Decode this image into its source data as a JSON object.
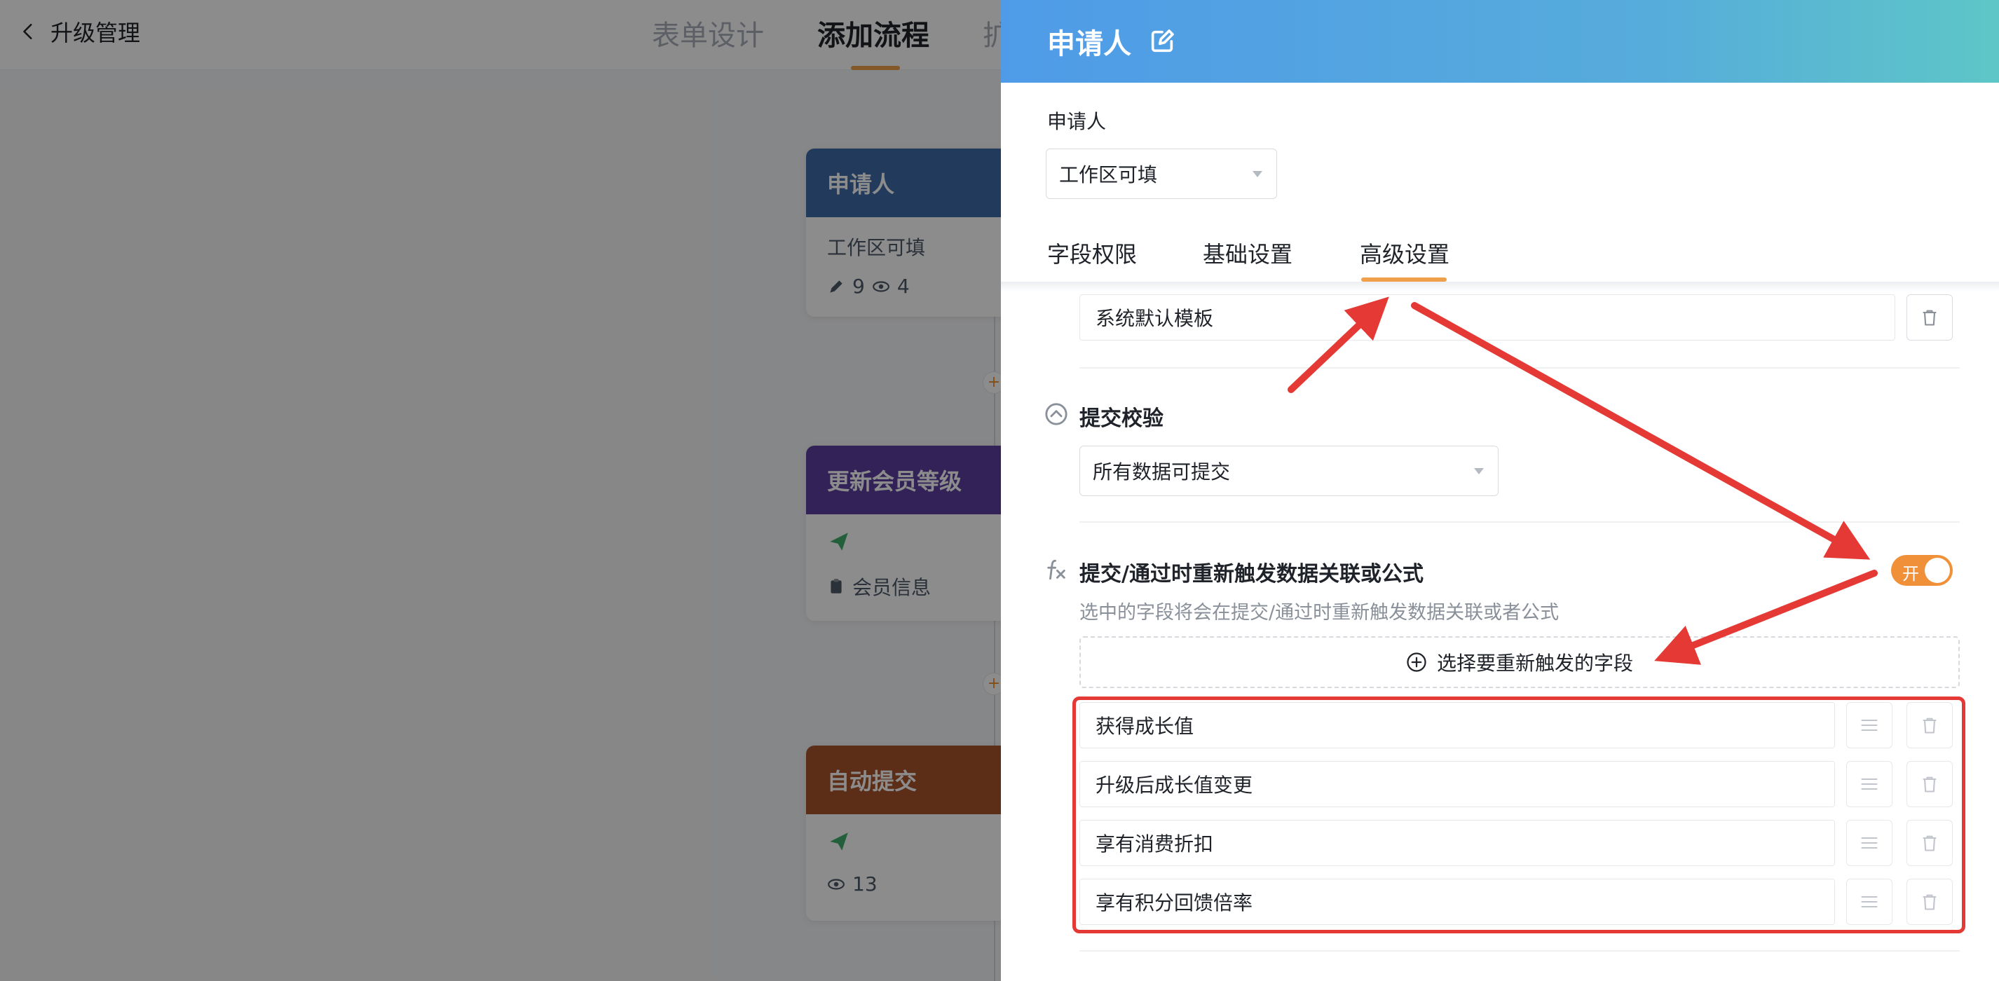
{
  "colors": {
    "accent": "#f0a04b",
    "toggle_on": "#f0913a",
    "annotation_red": "#e53935",
    "node_applicant": "#3e6aa8",
    "node_update_member": "#5b3fa0",
    "node_auto_submit": "#a8552a",
    "drawer_header_start": "#4f9be8",
    "drawer_header_end": "#5ec6c7"
  },
  "topbar": {
    "back_label": "升级管理",
    "tabs": [
      "表单设计",
      "添加流程",
      "扩"
    ],
    "active_tab": "添加流程"
  },
  "flow": {
    "nodes": [
      {
        "title": "申请人",
        "subtitle": "工作区可填",
        "edit_count": "9",
        "view_count": "4"
      },
      {
        "title": "更新会员等级",
        "field": "会员信息"
      },
      {
        "title": "自动提交",
        "view_count": "13"
      }
    ],
    "add_symbol": "+"
  },
  "drawer": {
    "title": "申请人",
    "applicant_label": "申请人",
    "applicant_select": "工作区可填",
    "tabs": [
      "字段权限",
      "基础设置",
      "高级设置"
    ],
    "active_tab": "高级设置",
    "template_value": "系统默认模板",
    "submit_check": {
      "title": "提交校验",
      "select_value": "所有数据可提交"
    },
    "retrigger": {
      "title": "提交/通过时重新触发数据关联或公式",
      "description": "选中的字段将会在提交/通过时重新触发数据关联或者公式",
      "toggle_label": "开",
      "toggle_on": true,
      "add_button_label": "选择要重新触发的字段",
      "fields": [
        "获得成长值",
        "升级后成长值变更",
        "享有消费折扣",
        "享有积分回馈倍率"
      ]
    }
  }
}
